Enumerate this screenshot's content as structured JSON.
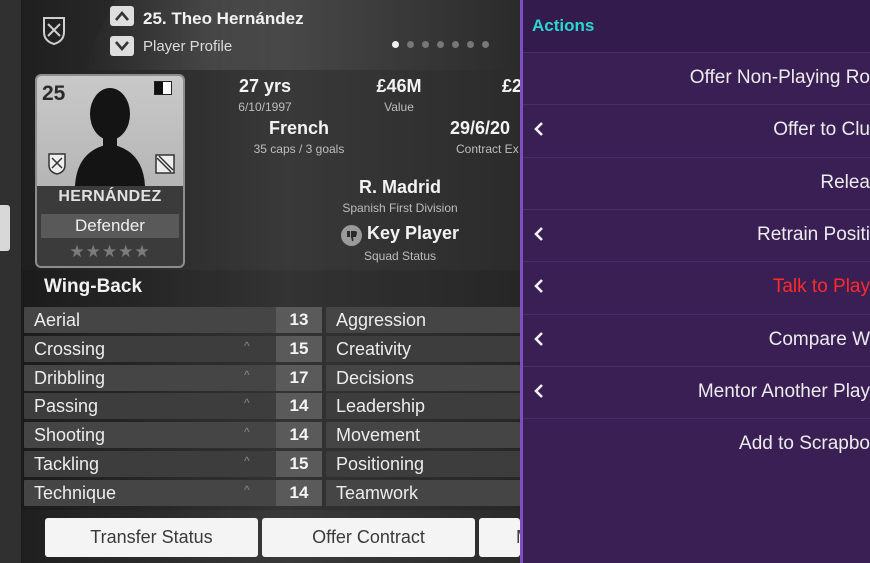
{
  "header": {
    "title": "25. Theo Hernández",
    "subtitle": "Player Profile",
    "page_count": 7,
    "active_page": 0
  },
  "card": {
    "number": "25",
    "name": "HERNÁNDEZ",
    "position": "Defender",
    "stars": "★★★★★"
  },
  "info": {
    "age": "27 yrs",
    "dob": "6/10/1997",
    "value": "£46M",
    "value_label": "Value",
    "wage_partial": "£2",
    "nationality": "French",
    "caps": "35 caps / 3 goals",
    "contract": "29/6/20",
    "contract_label": "Contract Ex",
    "club": "R. Madrid",
    "league": "Spanish First Division",
    "squad_status": "Key Player",
    "squad_status_label": "Squad Status"
  },
  "attributes": {
    "role": "Wing-Back",
    "rows": [
      {
        "name": "Aerial",
        "value": "13",
        "right": "Aggression"
      },
      {
        "name": "Crossing",
        "value": "15",
        "right": "Creativity",
        "caret": "^"
      },
      {
        "name": "Dribbling",
        "value": "17",
        "right": "Decisions",
        "caret": "^"
      },
      {
        "name": "Passing",
        "value": "14",
        "right": "Leadership",
        "caret": "^"
      },
      {
        "name": "Shooting",
        "value": "14",
        "right": "Movement",
        "caret": "^"
      },
      {
        "name": "Tackling",
        "value": "15",
        "right": "Positioning",
        "caret": "^"
      },
      {
        "name": "Technique",
        "value": "14",
        "right": "Teamwork",
        "caret": "^"
      }
    ]
  },
  "buttons": {
    "transfer_status": "Transfer Status",
    "offer_contract": "Offer Contract",
    "more_partial": "M"
  },
  "actions": {
    "title": "Actions",
    "items": [
      {
        "label": "Offer Non-Playing Ro",
        "submenu": false,
        "danger": false
      },
      {
        "label": "Offer to Clu",
        "submenu": true,
        "danger": false
      },
      {
        "label": "Relea",
        "submenu": false,
        "danger": false
      },
      {
        "label": "Retrain Positi",
        "submenu": true,
        "danger": false
      },
      {
        "label": "Talk to Play",
        "submenu": true,
        "danger": true
      },
      {
        "label": "Compare W",
        "submenu": true,
        "danger": false
      },
      {
        "label": "Mentor Another Play",
        "submenu": true,
        "danger": false
      },
      {
        "label": "Add to Scrapbo",
        "submenu": false,
        "danger": false
      }
    ]
  },
  "colors": {
    "actions_bg": "#3a1f55",
    "actions_border": "#7d4fc2",
    "actions_title": "#2ad7d0",
    "danger": "#ff2a2a"
  }
}
